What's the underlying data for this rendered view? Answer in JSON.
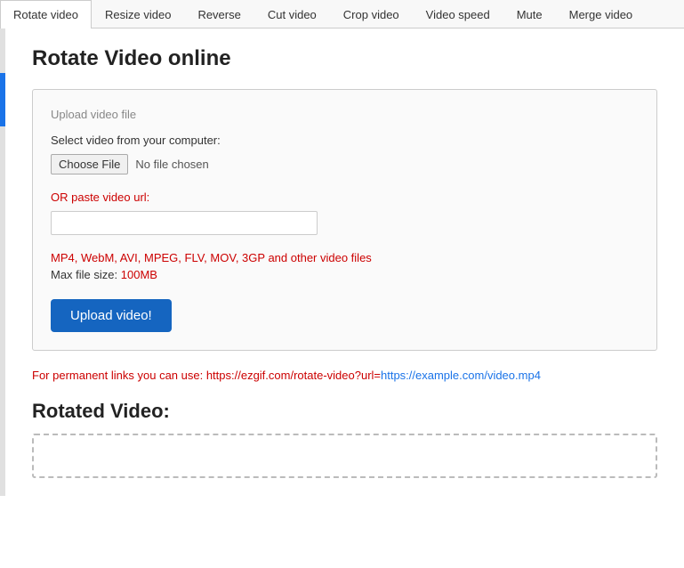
{
  "tabs": [
    {
      "label": "Rotate video",
      "active": true
    },
    {
      "label": "Resize video",
      "active": false
    },
    {
      "label": "Reverse",
      "active": false
    },
    {
      "label": "Cut video",
      "active": false
    },
    {
      "label": "Crop video",
      "active": false
    },
    {
      "label": "Video speed",
      "active": false
    },
    {
      "label": "Mute",
      "active": false
    },
    {
      "label": "Merge video",
      "active": false
    }
  ],
  "page": {
    "title": "Rotate Video online",
    "upload_section": {
      "legend": "Upload video file",
      "select_label": "Select video from your computer:",
      "choose_file_btn": "Choose File",
      "no_file_text": "No file chosen",
      "or_label": "OR paste video url:",
      "url_placeholder": "",
      "formats_text": "MP4, WebM, AVI, MPEG, FLV, MOV, 3GP and other video files",
      "maxsize_label": "Max file size: ",
      "maxsize_value": "100MB",
      "upload_btn": "Upload video!"
    },
    "perm_link": {
      "static": "For permanent links you can use: https://ezgif.com/rotate-video?url=",
      "url": "https://example.com/video.mp4"
    },
    "rotated_section": {
      "title": "Rotated Video:"
    }
  }
}
